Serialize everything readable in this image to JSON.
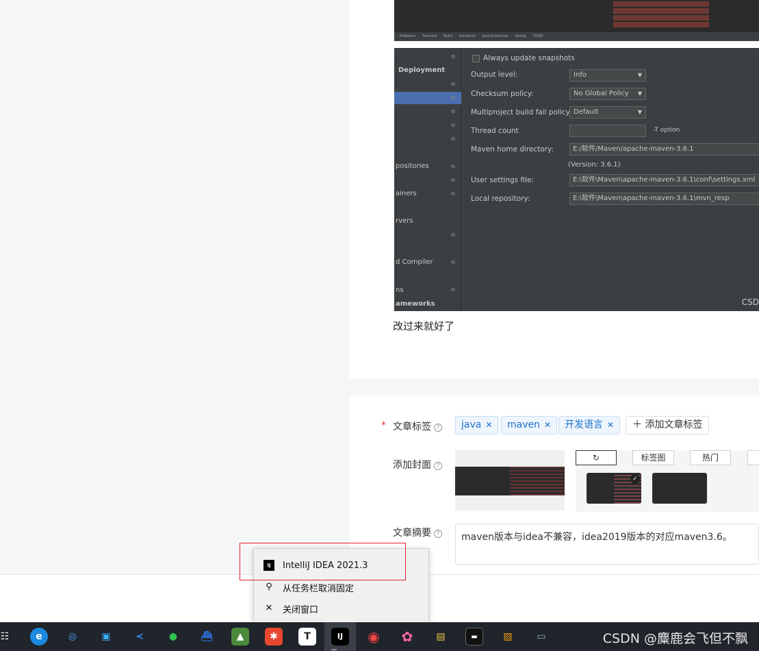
{
  "ide_settings": {
    "always_update": "Always update snapshots",
    "output_level_label": "Output level:",
    "output_level": "Info",
    "checksum_label": "Checksum policy:",
    "checksum": "No Global Policy",
    "fail_label": "Multiproject build fail policy:",
    "fail": "Default",
    "thread_label": "Thread count",
    "thread_hint": "-T option",
    "home_label": "Maven home directory:",
    "home": "E:/软件/Maven/apache-maven-3.6.1",
    "version": "(Version: 3.6.1)",
    "user_settings_label": "User settings file:",
    "user_settings": "E:\\软件\\Maven\\apache-maven-3.6.1\\conf\\settings.xml",
    "local_repo_label": "Local repository:",
    "local_repo": "E:\\软件\\Maven\\apache-maven-3.6.1\\mvn_resp",
    "sidebar": [
      "Deployment",
      "positories",
      "ainers",
      "rvers",
      "d Compiler",
      "ns",
      "ameworks"
    ],
    "csd": "CSD"
  },
  "ide_toolbar": [
    "Problems",
    "Terminal",
    "Build",
    "SonarLint",
    "Java Enterprise",
    "Spring",
    "TODO"
  ],
  "article_text": "改过来就好了",
  "form": {
    "tags_label": "文章标签",
    "tags": [
      "java",
      "maven",
      "开发语言"
    ],
    "add_tag": "添加文章标签",
    "cover_label": "添加封面",
    "cover_tabs": [
      "标签图",
      "热门"
    ],
    "summary_label": "文章摘要",
    "summary": "maven版本与idea不兼容，idea2019版本的对应maven3.6。"
  },
  "jumplist": {
    "app": "IntelliJ IDEA 2021.3",
    "unpin": "从任务栏取消固定",
    "close": "关闭窗口"
  },
  "watermark": "CSDN @麋鹿会飞但不飘"
}
